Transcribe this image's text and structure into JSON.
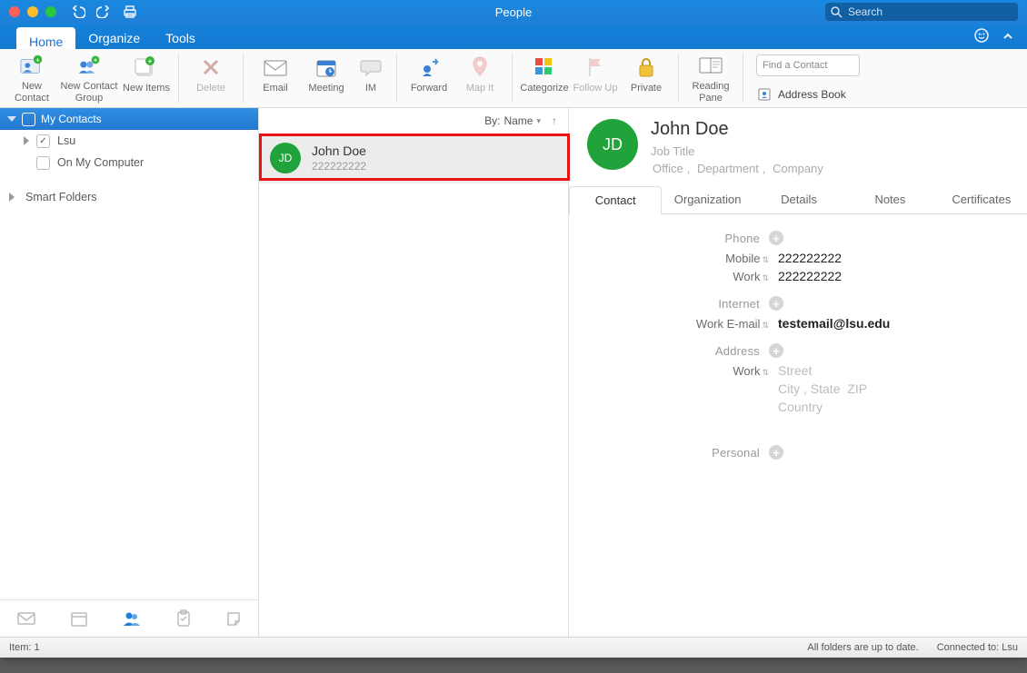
{
  "window": {
    "title": "People"
  },
  "traffic": {
    "close": "close-window",
    "minimize": "minimize-window",
    "zoom": "zoom-window"
  },
  "search": {
    "placeholder": "Search"
  },
  "ribbon": {
    "tabs": {
      "home": "Home",
      "organize": "Organize",
      "tools": "Tools"
    },
    "active_tab": "home"
  },
  "toolbar": {
    "new_contact": "New Contact",
    "new_group": "New Contact Group",
    "new_items": "New Items",
    "delete": "Delete",
    "email": "Email",
    "meeting": "Meeting",
    "im": "IM",
    "forward": "Forward",
    "map_it": "Map It",
    "categorize": "Categorize",
    "follow_up": "Follow Up",
    "private": "Private",
    "reading_pane": "Reading Pane",
    "find_placeholder": "Find a Contact",
    "address_book": "Address Book"
  },
  "sidebar": {
    "my_contacts": "My Contacts",
    "items": [
      {
        "label": "Lsu",
        "checked": true
      },
      {
        "label": "On My Computer",
        "checked": false
      }
    ],
    "smart_folders": "Smart Folders"
  },
  "nav_footer": {
    "mail": "mail",
    "calendar": "calendar",
    "people": "people",
    "tasks": "tasks",
    "notes": "notes"
  },
  "list": {
    "sort_prefix": "By:",
    "sort_field": "Name",
    "items": [
      {
        "initials": "JD",
        "name": "John Doe",
        "phone": "222222222"
      }
    ]
  },
  "detail": {
    "initials": "JD",
    "name": "John Doe",
    "job_title_placeholder": "Job Title",
    "office_placeholder": "Office",
    "department_placeholder": "Department",
    "company_placeholder": "Company",
    "tabs": {
      "contact": "Contact",
      "organization": "Organization",
      "details": "Details",
      "notes": "Notes",
      "certificates": "Certificates"
    },
    "sections": {
      "phone": "Phone",
      "internet": "Internet",
      "address": "Address",
      "personal": "Personal"
    },
    "fields": {
      "mobile_label": "Mobile",
      "mobile_value": "222222222",
      "work_phone_label": "Work",
      "work_phone_value": "222222222",
      "work_email_label": "Work E-mail",
      "work_email_value": "testemail@lsu.edu",
      "work_addr_label": "Work",
      "street_placeholder": "Street",
      "city_placeholder": "City",
      "state_placeholder": "State",
      "zip_placeholder": "ZIP",
      "country_placeholder": "Country"
    }
  },
  "statusbar": {
    "item_count_label": "Item:",
    "item_count": "1",
    "sync_status": "All folders are up to date.",
    "connection": "Connected to: Lsu"
  },
  "colors": {
    "accent": "#1e7fd6",
    "avatar_green": "#1fa33a"
  }
}
